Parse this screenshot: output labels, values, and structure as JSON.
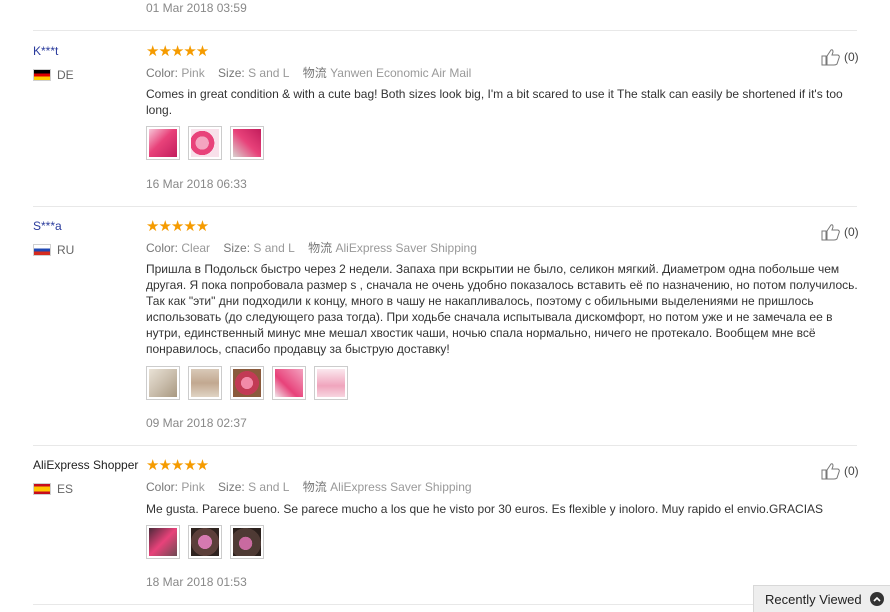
{
  "top_date": "01 Mar 2018 03:59",
  "reviews": [
    {
      "user": "K***t",
      "country": "DE",
      "stars": "★★★★★",
      "color_key": "Color:",
      "color_val": "Pink",
      "size_key": "Size:",
      "size_val": "S and L",
      "ship_key": "物流",
      "ship_val": "Yanwen Economic Air Mail",
      "text": "Comes in great condition & with a cute bag! Both sizes look big, I'm a bit scared to use it The stalk can easily be shortened if it's too long.",
      "date": "16 Mar 2018 06:33",
      "helpful": "(0)"
    },
    {
      "user": "S***a",
      "country": "RU",
      "stars": "★★★★★",
      "color_key": "Color:",
      "color_val": "Clear",
      "size_key": "Size:",
      "size_val": "S and L",
      "ship_key": "物流",
      "ship_val": "AliExpress Saver Shipping",
      "text": "Пришла в Подольск быстро через 2 недели. Запаха при вскрытии не было, селикон мягкий. Диаметром одна побольше чем другая. Я пока попробовала размер s , сначала не очень удобно показалось вставить её по назначению, но потом получилось. Так как \"эти\" дни подходили к концу, много в чашу не накапливалось, поэтому с обильными выделениями не пришлось использовать (до следующего раза тогда). При ходьбе сначала испытывала дискомфорт, но потом уже и не замечала ее в нутри, единственный минус мне мешал хвостик чаши, ночью спала нормально, ничего не протекало. Вообщем мне всё понравилось, спасибо продавцу за быструю доставку!",
      "date": "09 Mar 2018 02:37",
      "helpful": "(0)"
    },
    {
      "user": "AliExpress Shopper",
      "country": "ES",
      "stars": "★★★★★",
      "color_key": "Color:",
      "color_val": "Pink",
      "size_key": "Size:",
      "size_val": "S and L",
      "ship_key": "物流",
      "ship_val": "AliExpress Saver Shipping",
      "text": "Me gusta. Parece bueno. Se parece mucho a los que he visto por 30 euros. Es flexible y inoloro. Muy rapido el envio.GRACIAS",
      "date": "18 Mar 2018 01:53",
      "helpful": "(0)"
    }
  ],
  "recently_viewed": "Recently Viewed",
  "colors": {
    "star": "#f59b00",
    "username": "#2a3b9c",
    "thumb_pink": "#e8427a"
  }
}
